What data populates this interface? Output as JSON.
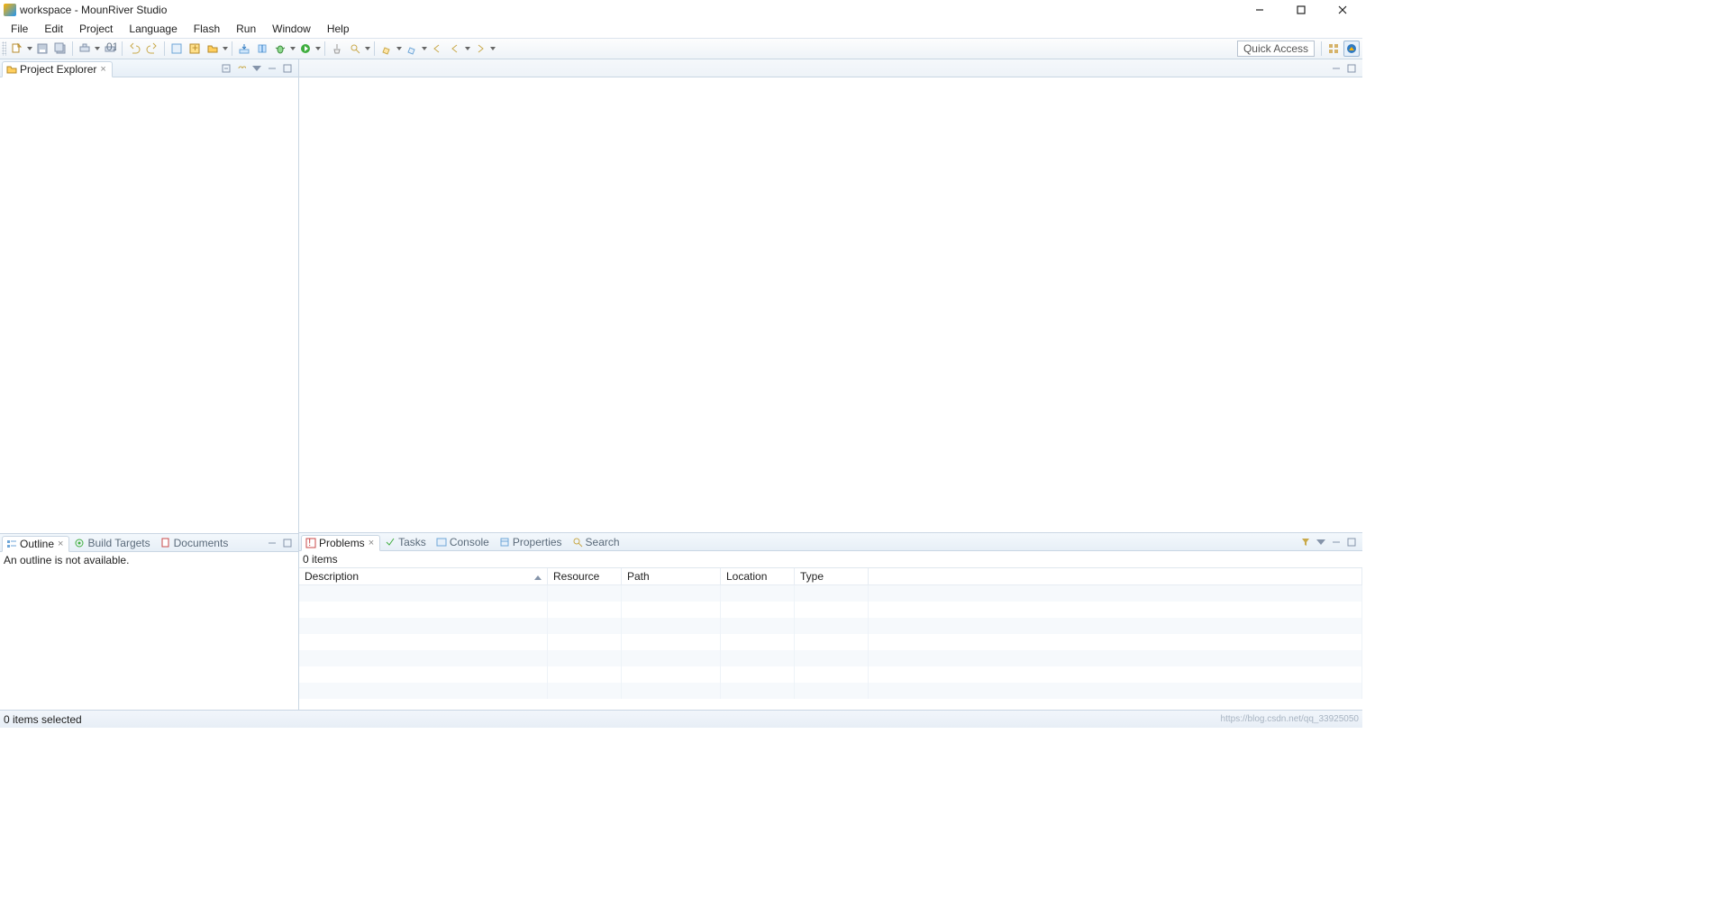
{
  "title": "workspace - MounRiver Studio",
  "menu": [
    "File",
    "Edit",
    "Project",
    "Language",
    "Flash",
    "Run",
    "Window",
    "Help"
  ],
  "quick_access": "Quick Access",
  "left": {
    "project_explorer": {
      "label": "Project Explorer"
    },
    "outline": {
      "label": "Outline",
      "message": "An outline is not available.",
      "other_tabs": [
        "Build Targets",
        "Documents"
      ]
    }
  },
  "bottom": {
    "problems": {
      "label": "Problems",
      "items_count": "0 items",
      "columns": [
        "Description",
        "Resource",
        "Path",
        "Location",
        "Type"
      ],
      "other_tabs": [
        "Tasks",
        "Console",
        "Properties",
        "Search"
      ]
    }
  },
  "statusbar": {
    "text": "0 items selected",
    "watermark": "https://blog.csdn.net/qq_33925050"
  }
}
